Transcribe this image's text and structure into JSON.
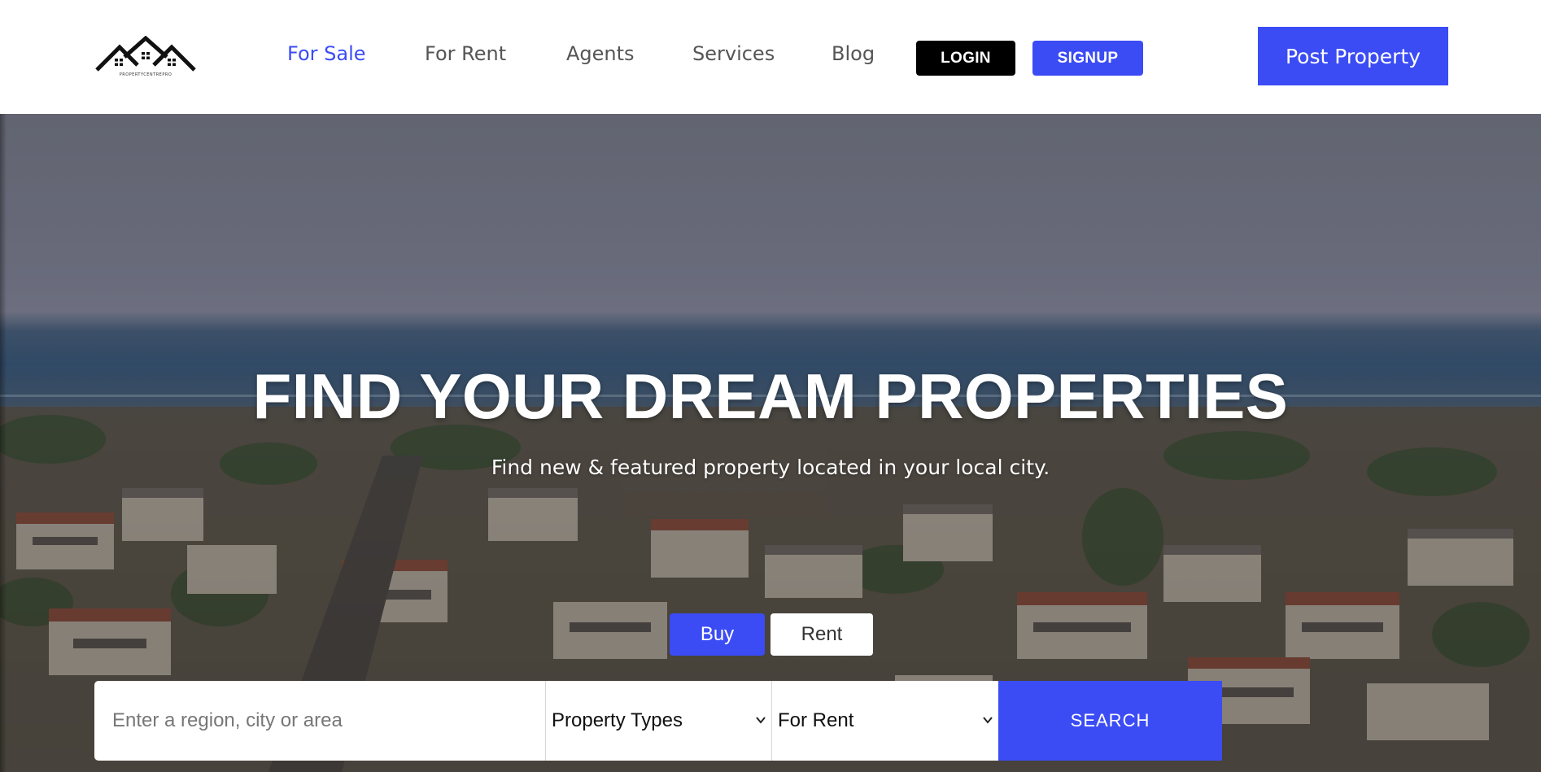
{
  "header": {
    "logo_caption": "PROPERTYCENTREPRO",
    "nav": [
      {
        "label": "For Sale",
        "active": true
      },
      {
        "label": "For Rent",
        "active": false
      },
      {
        "label": "Agents",
        "active": false
      },
      {
        "label": "Services",
        "active": false
      },
      {
        "label": "Blog",
        "active": false
      }
    ],
    "login_label": "LOGIN",
    "signup_label": "SIGNUP",
    "post_property_label": "Post Property"
  },
  "hero": {
    "title": "FIND YOUR DREAM PROPERTIES",
    "subtitle": "Find new & featured property located in your local city.",
    "tabs": {
      "buy_label": "Buy",
      "rent_label": "Rent",
      "selected": "Buy"
    },
    "search": {
      "placeholder": "Enter a region, city or area",
      "value": "",
      "property_type": "Property Types",
      "listing_status": "For Rent",
      "button_label": "SEARCH"
    }
  },
  "colors": {
    "accent": "#3b4cf5",
    "login_bg": "#000000",
    "nav_text": "#555555"
  },
  "icons": [
    "logo-house-icon",
    "chevron-down-icon"
  ]
}
